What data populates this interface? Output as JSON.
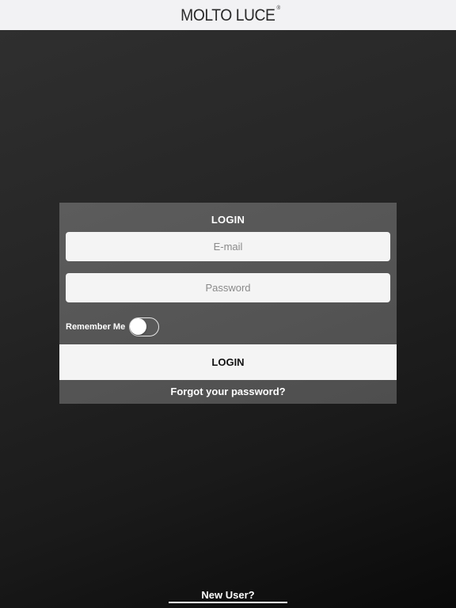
{
  "header": {
    "brand": "MOLTO LUCE",
    "brand_mark": "®",
    "background": "#f2f2f4"
  },
  "login_panel": {
    "title": "LOGIN",
    "email": {
      "value": "",
      "placeholder": "E-mail"
    },
    "password": {
      "value": "",
      "placeholder": "Password"
    },
    "remember_me": {
      "label": "Remember Me",
      "checked": false
    },
    "login_button": "LOGIN",
    "forgot_password": "Forgot your password?"
  },
  "footer": {
    "new_user": "New User?"
  }
}
